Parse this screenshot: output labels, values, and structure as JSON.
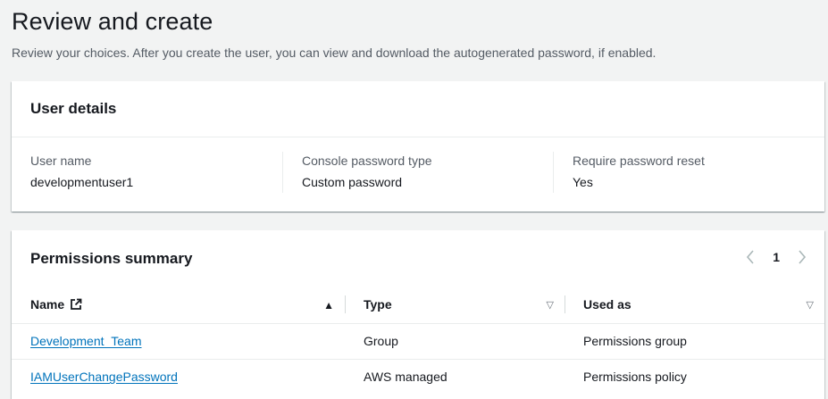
{
  "page": {
    "title": "Review and create",
    "description": "Review your choices. After you create the user, you can view and download the autogenerated password, if enabled."
  },
  "user_details": {
    "title": "User details",
    "fields": [
      {
        "label": "User name",
        "value": "developmentuser1"
      },
      {
        "label": "Console password type",
        "value": "Custom password"
      },
      {
        "label": "Require password reset",
        "value": "Yes"
      }
    ]
  },
  "permissions": {
    "title": "Permissions summary",
    "pagination": {
      "current_page": "1"
    },
    "columns": [
      {
        "label": "Name",
        "icon": "external-link-icon",
        "sort": "ascending"
      },
      {
        "label": "Type",
        "sort": "none"
      },
      {
        "label": "Used as",
        "sort": "none"
      }
    ],
    "rows": [
      {
        "name": "Development_Team",
        "type": "Group",
        "used_as": "Permissions group"
      },
      {
        "name": "IAMUserChangePassword",
        "type": "AWS managed",
        "used_as": "Permissions policy"
      }
    ]
  },
  "colors": {
    "link": "#0073bb",
    "text": "#16191f",
    "secondary_text": "#545b64",
    "background": "#f2f3f3"
  }
}
